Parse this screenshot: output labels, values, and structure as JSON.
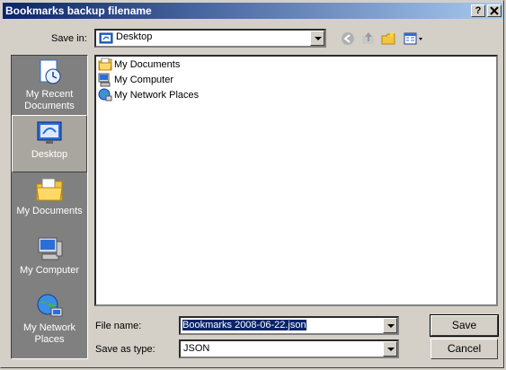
{
  "window": {
    "title": "Bookmarks backup filename"
  },
  "titlebar_buttons": {
    "help": "?",
    "close": "X"
  },
  "savein": {
    "label": "Save in:",
    "value": "Desktop"
  },
  "places": [
    {
      "label": "My Recent Documents",
      "icon": "recent-docs-icon"
    },
    {
      "label": "Desktop",
      "icon": "desktop-icon",
      "selected": true
    },
    {
      "label": "My Documents",
      "icon": "my-documents-icon"
    },
    {
      "label": "My Computer",
      "icon": "my-computer-icon"
    },
    {
      "label": "My Network Places",
      "icon": "network-places-icon"
    }
  ],
  "files": [
    {
      "label": "My Documents",
      "icon": "folder-icon"
    },
    {
      "label": "My Computer",
      "icon": "computer-icon"
    },
    {
      "label": "My Network Places",
      "icon": "network-icon"
    }
  ],
  "filename": {
    "label": "File name:",
    "value": "Bookmarks 2008-06-22.json"
  },
  "filetype": {
    "label": "Save as type:",
    "value": "JSON"
  },
  "buttons": {
    "save": "Save",
    "cancel": "Cancel"
  },
  "colors": {
    "titlebar_start": "#0a246a",
    "titlebar_end": "#a6caf0",
    "places_bg": "#808080",
    "face": "#d4d0c8"
  }
}
